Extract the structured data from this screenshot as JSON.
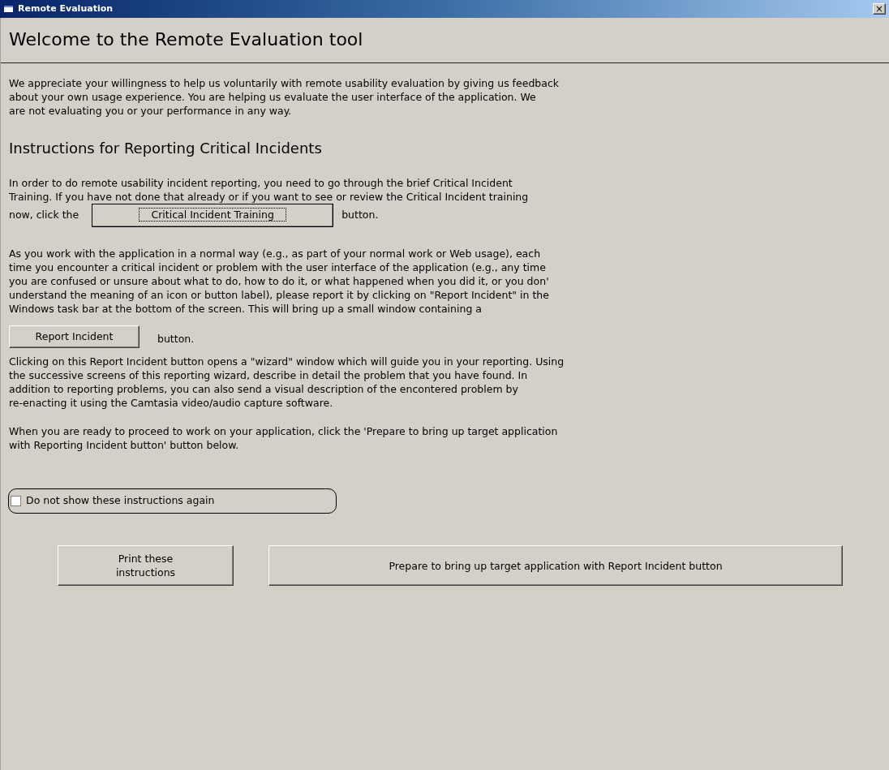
{
  "window": {
    "title": "Remote Evaluation",
    "close": "×"
  },
  "heading": "Welcome to the Remote Evaluation tool",
  "intro": [
    "We appreciate your willingness to help us voluntarily with remote usability evaluation by giving us feedback",
    "about your own usage experience. You are helping us evaluate the user interface of the application. We",
    "are not evaluating you or your performance in any way."
  ],
  "section_heading": "Instructions for Reporting Critical Incidents",
  "training": {
    "lines": [
      "In order to do remote usability incident reporting, you need to go through the brief Critical Incident",
      "Training. If you have not done that already or if you want to see or review the Critical Incident training"
    ],
    "before": "now, click the",
    "button": "Critical Incident Training",
    "after": "button."
  },
  "usage": [
    "As you work with the application in a normal way (e.g., as part of your normal work or Web usage), each",
    "time you encounter a critical incident or problem with the user interface of the application (e.g., any time",
    "you are confused or unsure about what to do, how to do it, or what happened when you did it, or you don'",
    "understand the meaning of an icon or button label), please report it by clicking on \"Report Incident\" in the",
    "Windows task bar at the bottom of the screen. This will bring up a small window containing a"
  ],
  "report": {
    "button": "Report Incident",
    "after": "button."
  },
  "wizard": [
    "Clicking on this Report Incident button opens a \"wizard\" window which will guide you in your reporting. Using",
    "the successive screens of this reporting wizard, describe in detail the problem that you have found. In",
    "addition to reporting problems, you can also send a visual description of the encontered problem by",
    "re-enacting it using the Camtasia video/audio capture software."
  ],
  "ready": [
    "When you are ready to proceed to work on your application, click the 'Prepare to bring up target application",
    "with Reporting Incident button' button below."
  ],
  "checkbox": {
    "label": "Do not show these instructions again",
    "checked": false
  },
  "buttons": [
    {
      "lines": [
        "Print these",
        "instructions"
      ]
    },
    {
      "lines": [
        "Prepare to bring up target application with Report Incident button"
      ]
    }
  ]
}
